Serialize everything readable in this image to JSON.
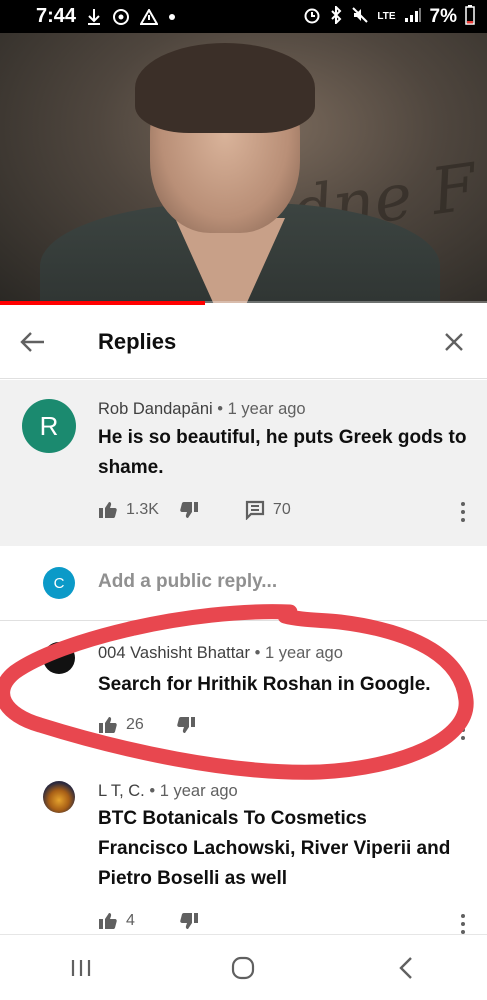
{
  "status_bar": {
    "time": "7:44",
    "network": "LTE",
    "battery": "7%"
  },
  "video": {
    "progress": 0.42,
    "accent": "#ff0000"
  },
  "replies_panel": {
    "title": "Replies"
  },
  "parent_comment": {
    "avatar_letter": "R",
    "avatar_color": "#1b8a6f",
    "author": "Rob Dandapāni",
    "time": "1 year ago",
    "text": "He is so beautiful, he puts Greek gods to shame.",
    "likes": "1.3K",
    "replies": "70"
  },
  "add_reply": {
    "avatar_letter": "C",
    "placeholder": "Add a public reply..."
  },
  "replies": [
    {
      "author": "004 Vashisht Bhattar",
      "time": "1 year ago",
      "text": "Search for Hrithik Roshan in Google.",
      "likes": "26"
    },
    {
      "author": "L T, C.",
      "time": "1 year ago",
      "text_lines": [
        "BTC Botanicals To Cosmetics",
        "Francisco Lachowski, River Viperii and",
        "Pietro Boselli as well"
      ],
      "likes": "4"
    }
  ],
  "separator": "•",
  "annotation_color": "#e8474f"
}
